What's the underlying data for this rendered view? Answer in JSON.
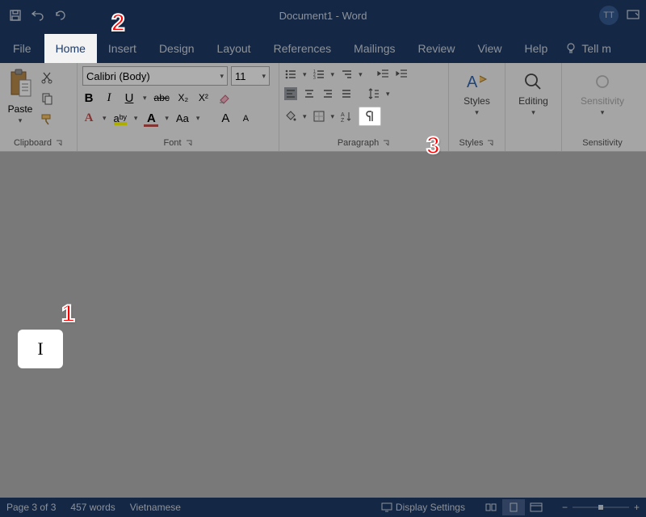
{
  "title": "Document1  -  Word",
  "avatar": "TT",
  "tabs": {
    "file": "File",
    "home": "Home",
    "insert": "Insert",
    "design": "Design",
    "layout": "Layout",
    "references": "References",
    "mailings": "Mailings",
    "review": "Review",
    "view": "View",
    "help": "Help",
    "tellme": "Tell m"
  },
  "clipboard": {
    "paste": "Paste",
    "label": "Clipboard"
  },
  "font": {
    "name": "Calibri (Body)",
    "size": "11",
    "bold": "B",
    "italic": "I",
    "underline": "U",
    "strike": "abc",
    "sub": "X₂",
    "sup": "X²",
    "effects": "A",
    "highlight": "aᵇʸ",
    "color": "A",
    "case": "Aa",
    "grow": "A",
    "shrink": "A",
    "label": "Font"
  },
  "paragraph": {
    "label": "Paragraph"
  },
  "styles": {
    "btn": "Styles",
    "label": "Styles"
  },
  "editing": {
    "btn": "Editing"
  },
  "sensitivity": {
    "btn": "Sensitivity",
    "label": "Sensitivity"
  },
  "cursor": "I",
  "status": {
    "page": "Page 3 of 3",
    "words": "457 words",
    "lang": "Vietnamese",
    "display": "Display Settings"
  },
  "callouts": {
    "c1": "1",
    "c2": "2",
    "c3": "3"
  }
}
